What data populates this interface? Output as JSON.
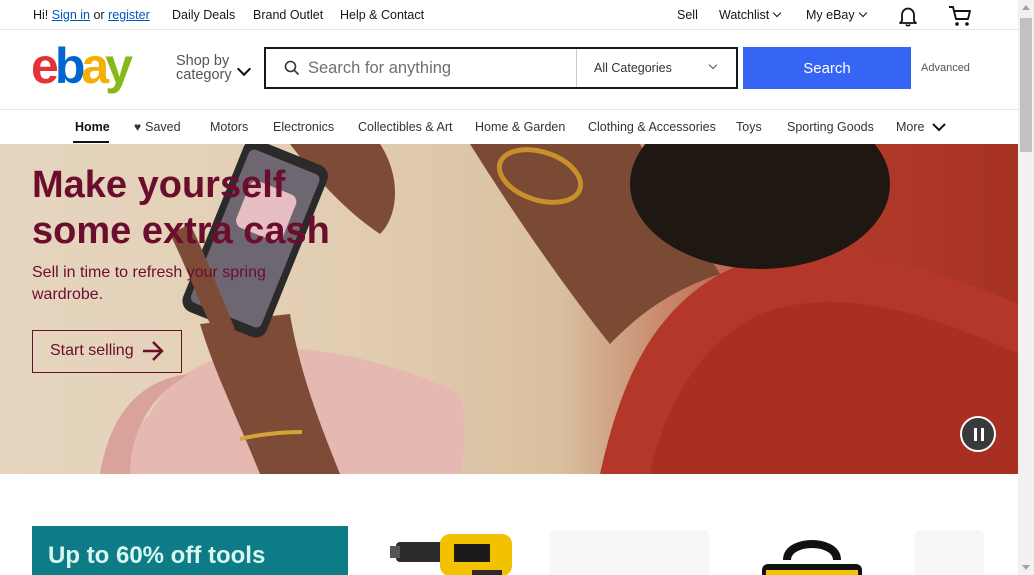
{
  "topbar": {
    "greeting": "Hi!",
    "sign_in": "Sign in",
    "or": "or",
    "register": "register",
    "daily_deals": "Daily Deals",
    "brand_outlet": "Brand Outlet",
    "help_contact": "Help & Contact",
    "sell": "Sell",
    "watchlist": "Watchlist",
    "my_ebay": "My eBay"
  },
  "header": {
    "logo_letters": [
      "e",
      "b",
      "a",
      "y"
    ],
    "logo_colors": [
      "#e53238",
      "#0064d2",
      "#f5af02",
      "#86b817"
    ],
    "shop_by_line1": "Shop by",
    "shop_by_line2": "category",
    "search_placeholder": "Search for anything",
    "category_select": "All Categories",
    "search_button": "Search",
    "advanced": "Advanced",
    "accent_color": "#3665f3"
  },
  "catnav": {
    "items": [
      "Home",
      "Saved",
      "Motors",
      "Electronics",
      "Collectibles & Art",
      "Home & Garden",
      "Clothing & Accessories",
      "Toys",
      "Sporting Goods",
      "More"
    ]
  },
  "hero": {
    "title_line1": "Make yourself",
    "title_line2": "some extra cash",
    "subtitle": "Sell in time to refresh your spring wardrobe.",
    "cta": "Start selling",
    "text_color": "#6b0d2d"
  },
  "promo": {
    "title": "Up to 60% off tools",
    "bg_color": "#0e7c86"
  },
  "icons": [
    "search-icon",
    "bell-icon",
    "cart-icon",
    "heart-icon",
    "chevron-down-icon",
    "arrow-right-icon",
    "pause-icon"
  ]
}
